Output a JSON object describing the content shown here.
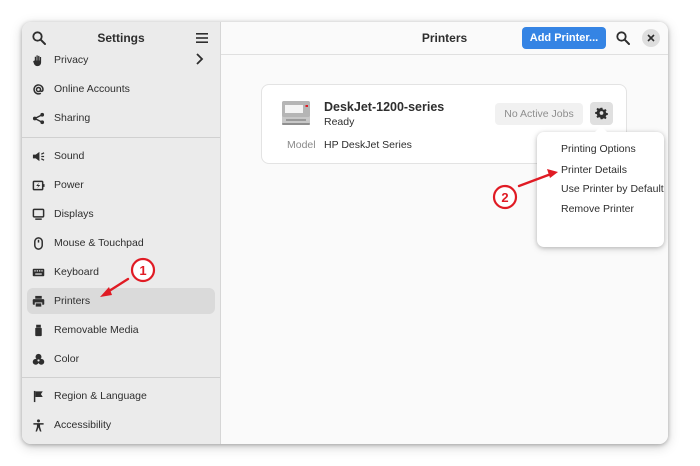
{
  "sidebar": {
    "title": "Settings",
    "items": [
      {
        "label": "Privacy",
        "icon": "hand-icon"
      },
      {
        "label": "Online Accounts",
        "icon": "at-icon"
      },
      {
        "label": "Sharing",
        "icon": "share-icon"
      },
      {
        "label": "Sound",
        "icon": "speaker-icon"
      },
      {
        "label": "Power",
        "icon": "battery-icon"
      },
      {
        "label": "Displays",
        "icon": "monitor-icon"
      },
      {
        "label": "Mouse & Touchpad",
        "icon": "mouse-icon"
      },
      {
        "label": "Keyboard",
        "icon": "keyboard-icon"
      },
      {
        "label": "Printers",
        "icon": "printer-icon",
        "selected": true
      },
      {
        "label": "Removable Media",
        "icon": "usb-icon"
      },
      {
        "label": "Color",
        "icon": "palette-icon"
      },
      {
        "label": "Region & Language",
        "icon": "flag-icon"
      },
      {
        "label": "Accessibility",
        "icon": "person-icon"
      }
    ]
  },
  "header": {
    "title": "Printers",
    "add_label": "Add Printer..."
  },
  "printer": {
    "name": "DeskJet-1200-series",
    "status": "Ready",
    "jobs_label": "No Active Jobs",
    "model_label": "Model",
    "model_value": "HP DeskJet Series"
  },
  "menu": {
    "items": [
      "Printing Options",
      "Printer Details",
      "Use Printer by Default",
      "Remove Printer"
    ]
  },
  "annotations": {
    "step1": "1",
    "step2": "2"
  },
  "colors": {
    "accent": "#3584e4",
    "annotation": "#e01b24"
  }
}
